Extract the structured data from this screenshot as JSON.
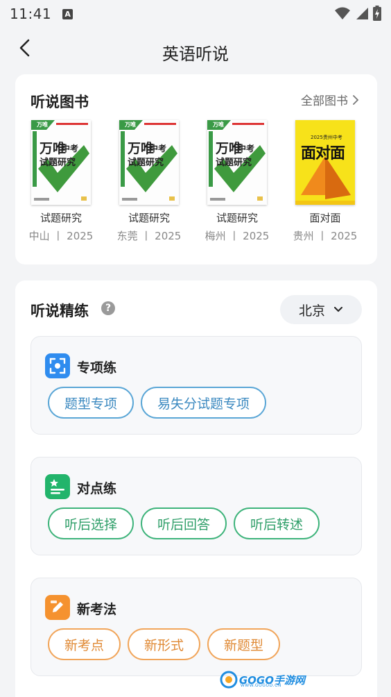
{
  "status_bar": {
    "time": "11:41",
    "notification_letter": "A"
  },
  "header": {
    "title": "英语听说"
  },
  "books_card": {
    "title": "听说图书",
    "all_books_label": "全部图书",
    "books": [
      {
        "name": "试题研究",
        "meta": "中山 丨 2025",
        "cover_brand": "万唯",
        "cover_line1": "中考",
        "cover_line2": "试题研究",
        "cover_tag": "万唯"
      },
      {
        "name": "试题研究",
        "meta": "东莞 丨 2025",
        "cover_brand": "万唯",
        "cover_line1": "中考",
        "cover_line2": "试题研究",
        "cover_tag": "万唯"
      },
      {
        "name": "试题研究",
        "meta": "梅州 丨 2025",
        "cover_brand": "万唯",
        "cover_line1": "中考",
        "cover_line2": "试题研究",
        "cover_tag": "万唯"
      },
      {
        "name": "面对面",
        "meta": "贵州 丨 2025",
        "cover_top": "2025贵州中考",
        "cover_title": "面对面"
      }
    ]
  },
  "practice_card": {
    "title": "听说精练",
    "help_symbol": "?",
    "city": "北京",
    "sections": [
      {
        "title": "专项练",
        "color": "#2f8cef",
        "icon": "scan-icon",
        "chips": [
          "题型专项",
          "易失分试题专项"
        ]
      },
      {
        "title": "对点练",
        "color": "#22b46b",
        "icon": "star-list-icon",
        "chips": [
          "听后选择",
          "听后回答",
          "听后转述"
        ]
      },
      {
        "title": "新考法",
        "color": "#f5922f",
        "icon": "pencil-icon",
        "chips": [
          "新考点",
          "新形式",
          "新题型"
        ]
      }
    ]
  },
  "watermark": {
    "text": "GOGO手游网",
    "sub": "WWW.GOGOD.CN"
  }
}
